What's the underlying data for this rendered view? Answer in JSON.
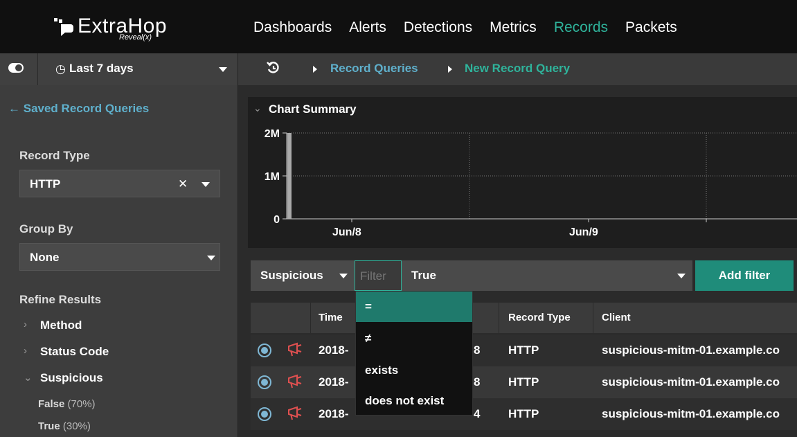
{
  "app": {
    "logo_text": "ExtraHop",
    "logo_sub": "Reveal(x)",
    "colors": {
      "accent": "#2fb39b",
      "link": "#5fb0cc",
      "bar": "#aaaaaa"
    }
  },
  "nav": {
    "items": [
      {
        "label": "Dashboards",
        "active": false
      },
      {
        "label": "Alerts",
        "active": false
      },
      {
        "label": "Detections",
        "active": false
      },
      {
        "label": "Metrics",
        "active": false
      },
      {
        "label": "Records",
        "active": true
      },
      {
        "label": "Packets",
        "active": false
      }
    ]
  },
  "subbar": {
    "time_range": "Last 7 days",
    "breadcrumbs": [
      {
        "label": "Record Queries"
      },
      {
        "label": "New Record Query"
      }
    ]
  },
  "sidebar": {
    "saved_link": "Saved Record Queries",
    "record_type_label": "Record Type",
    "record_type_value": "HTTP",
    "group_by_label": "Group By",
    "group_by_value": "None",
    "refine_label": "Refine Results",
    "refine_items": [
      {
        "label": "Method",
        "expanded": false
      },
      {
        "label": "Status Code",
        "expanded": false
      },
      {
        "label": "Suspicious",
        "expanded": true
      }
    ],
    "suspicious_values": [
      {
        "label": "False",
        "pct": "(70%)"
      },
      {
        "label": "True",
        "pct": "(30%)"
      }
    ]
  },
  "chart_data": {
    "type": "bar",
    "title": "Chart Summary",
    "y_ticks": [
      "2M",
      "1M",
      "0"
    ],
    "x_ticks": [
      "Jun/8",
      "Jun/9"
    ],
    "ylim": [
      0,
      2000000
    ],
    "values": [
      2000000
    ],
    "xlabel": "",
    "ylabel": "",
    "grid": true
  },
  "filter": {
    "field": "Suspicious",
    "operator_placeholder": "Filter",
    "value": "True",
    "add_label": "Add filter",
    "operator_options": [
      "=",
      "≠",
      "exists",
      "does not exist"
    ],
    "selected_option": "="
  },
  "table": {
    "columns": [
      "Time",
      "Record Type",
      "Client"
    ],
    "rows": [
      {
        "time": "2018-06-14 18:18:56.274",
        "time_visible_prefix": "2018-",
        "time_visible_suffix": "8",
        "record_type": "HTTP",
        "client": "suspicious-mitm-01.example.co"
      },
      {
        "time_visible_prefix": "2018-",
        "time_visible_suffix": "8",
        "record_type": "HTTP",
        "client": "suspicious-mitm-01.example.co"
      },
      {
        "time_visible_prefix": "2018-",
        "time_visible_suffix": "4",
        "record_type": "HTTP",
        "client": "suspicious-mitm-01.example.co"
      }
    ]
  }
}
